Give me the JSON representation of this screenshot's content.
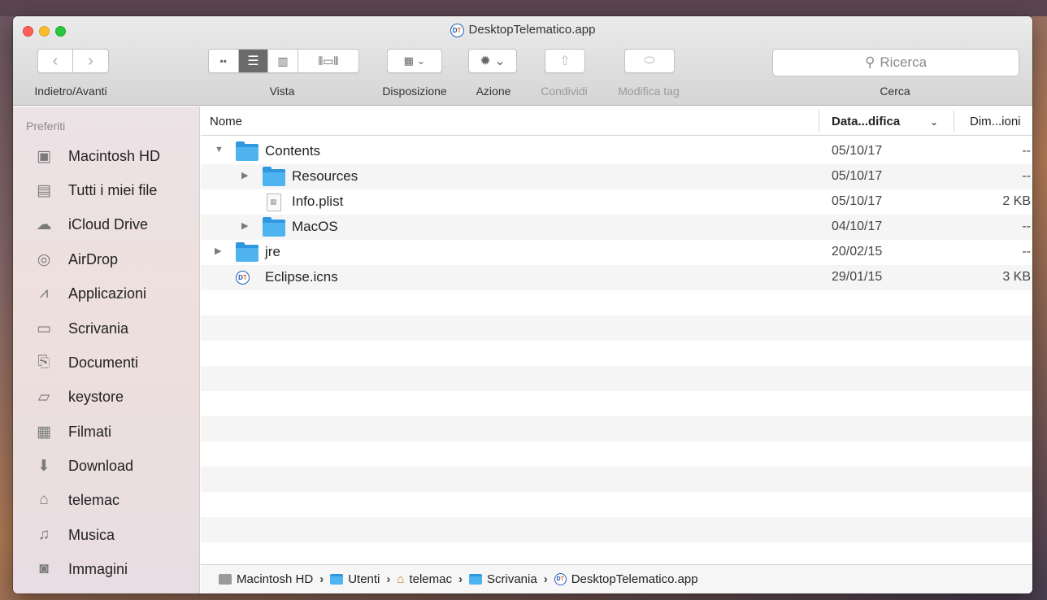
{
  "window": {
    "title": "DesktopTelematico.app",
    "app_badge": "DT"
  },
  "toolbar": {
    "nav_label": "Indietro/Avanti",
    "view_label": "Vista",
    "arrange_label": "Disposizione",
    "action_label": "Azione",
    "share_label": "Condividi",
    "tags_label": "Modifica tag",
    "search_label": "Cerca",
    "search_placeholder": "Ricerca"
  },
  "sidebar": {
    "heading": "Preferiti",
    "items": [
      {
        "label": "Macintosh HD",
        "icon": "disk-icon"
      },
      {
        "label": "Tutti i miei file",
        "icon": "all-files-icon"
      },
      {
        "label": "iCloud Drive",
        "icon": "cloud-icon"
      },
      {
        "label": "AirDrop",
        "icon": "airdrop-icon"
      },
      {
        "label": "Applicazioni",
        "icon": "applications-icon"
      },
      {
        "label": "Scrivania",
        "icon": "desktop-icon"
      },
      {
        "label": "Documenti",
        "icon": "documents-icon"
      },
      {
        "label": "keystore",
        "icon": "folder-icon"
      },
      {
        "label": "Filmati",
        "icon": "movies-icon"
      },
      {
        "label": "Download",
        "icon": "download-icon"
      },
      {
        "label": "telemac",
        "icon": "home-icon"
      },
      {
        "label": "Musica",
        "icon": "music-icon"
      },
      {
        "label": "Immagini",
        "icon": "camera-icon"
      }
    ]
  },
  "columns": {
    "name": "Nome",
    "date": "Data...difica",
    "size": "Dim...ioni"
  },
  "files": [
    {
      "name": "Contents",
      "date": "05/10/17",
      "size": "--",
      "type": "folder",
      "depth": 0,
      "expanded": true
    },
    {
      "name": "Resources",
      "date": "05/10/17",
      "size": "--",
      "type": "folder",
      "depth": 1,
      "expanded": false
    },
    {
      "name": "Info.plist",
      "date": "05/10/17",
      "size": "2 KB",
      "type": "file",
      "depth": 1
    },
    {
      "name": "MacOS",
      "date": "04/10/17",
      "size": "--",
      "type": "folder",
      "depth": 1,
      "expanded": false
    },
    {
      "name": "jre",
      "date": "20/02/15",
      "size": "--",
      "type": "folder",
      "depth": 0,
      "expanded": false
    },
    {
      "name": "Eclipse.icns",
      "date": "29/01/15",
      "size": "3 KB",
      "type": "app-file",
      "depth": 0
    }
  ],
  "pathbar": {
    "segments": [
      {
        "label": "Macintosh HD",
        "icon": "disk-icon"
      },
      {
        "label": "Utenti",
        "icon": "users-folder-icon"
      },
      {
        "label": "telemac",
        "icon": "home-icon"
      },
      {
        "label": "Scrivania",
        "icon": "desktop-folder-icon"
      },
      {
        "label": "DesktopTelematico.app",
        "icon": "app-icon"
      }
    ]
  }
}
